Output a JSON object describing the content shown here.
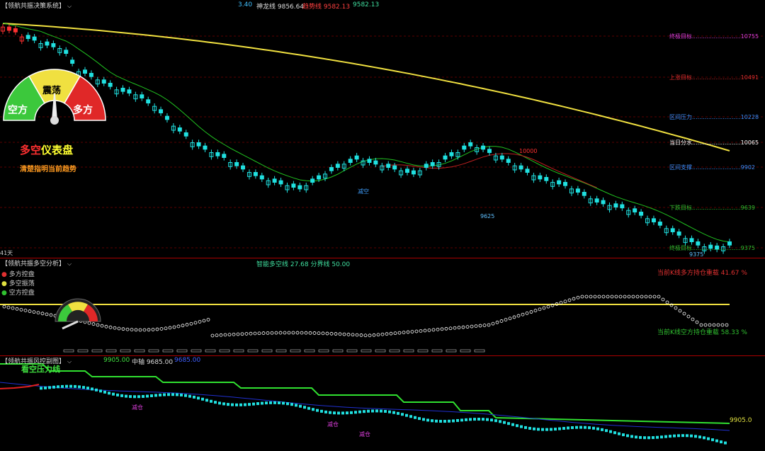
{
  "panel1": {
    "title": "【领航共振决策系统】",
    "header_values": [
      {
        "text": "3.40",
        "color": "#40c0ff"
      },
      {
        "text": "神龙线 9856.64",
        "color": "#dddddd"
      },
      {
        "text": "趋势线 9582.13",
        "color": "#ff4040"
      },
      {
        "text": "9582.13",
        "color": "#40e0a0"
      }
    ],
    "gauge": {
      "left": "空方",
      "center": "震荡",
      "right": "多方"
    },
    "gauge_title": "多空仪表盘",
    "gauge_subtitle": "清楚指明当前趋势",
    "targets": [
      {
        "label": "终极目标",
        "value": "10755",
        "color": "#e040e0"
      },
      {
        "label": "上涨目标",
        "value": "10491",
        "color": "#e03030"
      },
      {
        "label": "区间压力",
        "value": "10228",
        "color": "#4090ff"
      },
      {
        "label": "当日分水",
        "value": "10065",
        "color": "#ffffff"
      },
      {
        "label": "区间支撑",
        "value": "9902",
        "color": "#4090ff"
      },
      {
        "label": "下跌目标",
        "value": "9639",
        "color": "#30c030"
      },
      {
        "label": "终极目标",
        "value": "9375",
        "color": "#30c030"
      }
    ],
    "annotations": [
      "10000",
      "减空",
      "9625",
      "9375"
    ],
    "days": "41天"
  },
  "panel2": {
    "title": "【领航共振多空分析】",
    "header": "智能多空线 27.68  分界线 50.00",
    "legend": [
      {
        "text": "多方控盘",
        "color": "#e03030"
      },
      {
        "text": "多空振荡",
        "color": "#e0e040"
      },
      {
        "text": "空方控盘",
        "color": "#30c030"
      }
    ],
    "bull_weight": "当前K线多方持仓重载  41.67 %",
    "bear_weight": "当前K线空方持仓重载  58.33 %"
  },
  "panel3": {
    "title": "【领航共振风控副图】",
    "header": [
      {
        "text": "9905.00",
        "color": "#40e040"
      },
      {
        "text": "中轴 9685.00",
        "color": "#dddddd"
      },
      {
        "text": "9685.00",
        "color": "#4060ff"
      }
    ],
    "pressure_label": "看空压力线",
    "value_right": "9905.0",
    "marks": [
      "减仓",
      "减仓",
      "减仓"
    ]
  },
  "chart_data": {
    "type": "candlestick",
    "note": "approximate price series read from main panel",
    "price_range": [
      9375,
      10755
    ],
    "closes": [
      10720,
      10700,
      10690,
      10660,
      10650,
      10640,
      10620,
      10610,
      10600,
      10590,
      10560,
      10500,
      10450,
      10440,
      10420,
      10400,
      10380,
      10360,
      10340,
      10330,
      10320,
      10310,
      10290,
      10260,
      10240,
      10200,
      10160,
      10120,
      10090,
      10060,
      10020,
      10000,
      9980,
      9960,
      9940,
      9930,
      9900,
      9880,
      9860,
      9840,
      9820,
      9800,
      9790,
      9780,
      9770,
      9760,
      9750,
      9740,
      9760,
      9780,
      9800,
      9830,
      9850,
      9870,
      9890,
      9900,
      9920,
      9910,
      9900,
      9890,
      9880,
      9870,
      9860,
      9850,
      9840,
      9830,
      9850,
      9870,
      9880,
      9900,
      9920,
      9940,
      9960,
      9980,
      10000,
      9990,
      9980,
      9960,
      9940,
      9920,
      9900,
      9880,
      9860,
      9840,
      9820,
      9800,
      9790,
      9780,
      9770,
      9760,
      9740,
      9720,
      9700,
      9680,
      9660,
      9650,
      9640,
      9630,
      9625,
      9610,
      9600,
      9580,
      9560,
      9540,
      9520,
      9500,
      9480,
      9460,
      9440,
      9420,
      9400,
      9390,
      9380,
      9375,
      9390,
      9400
    ]
  }
}
